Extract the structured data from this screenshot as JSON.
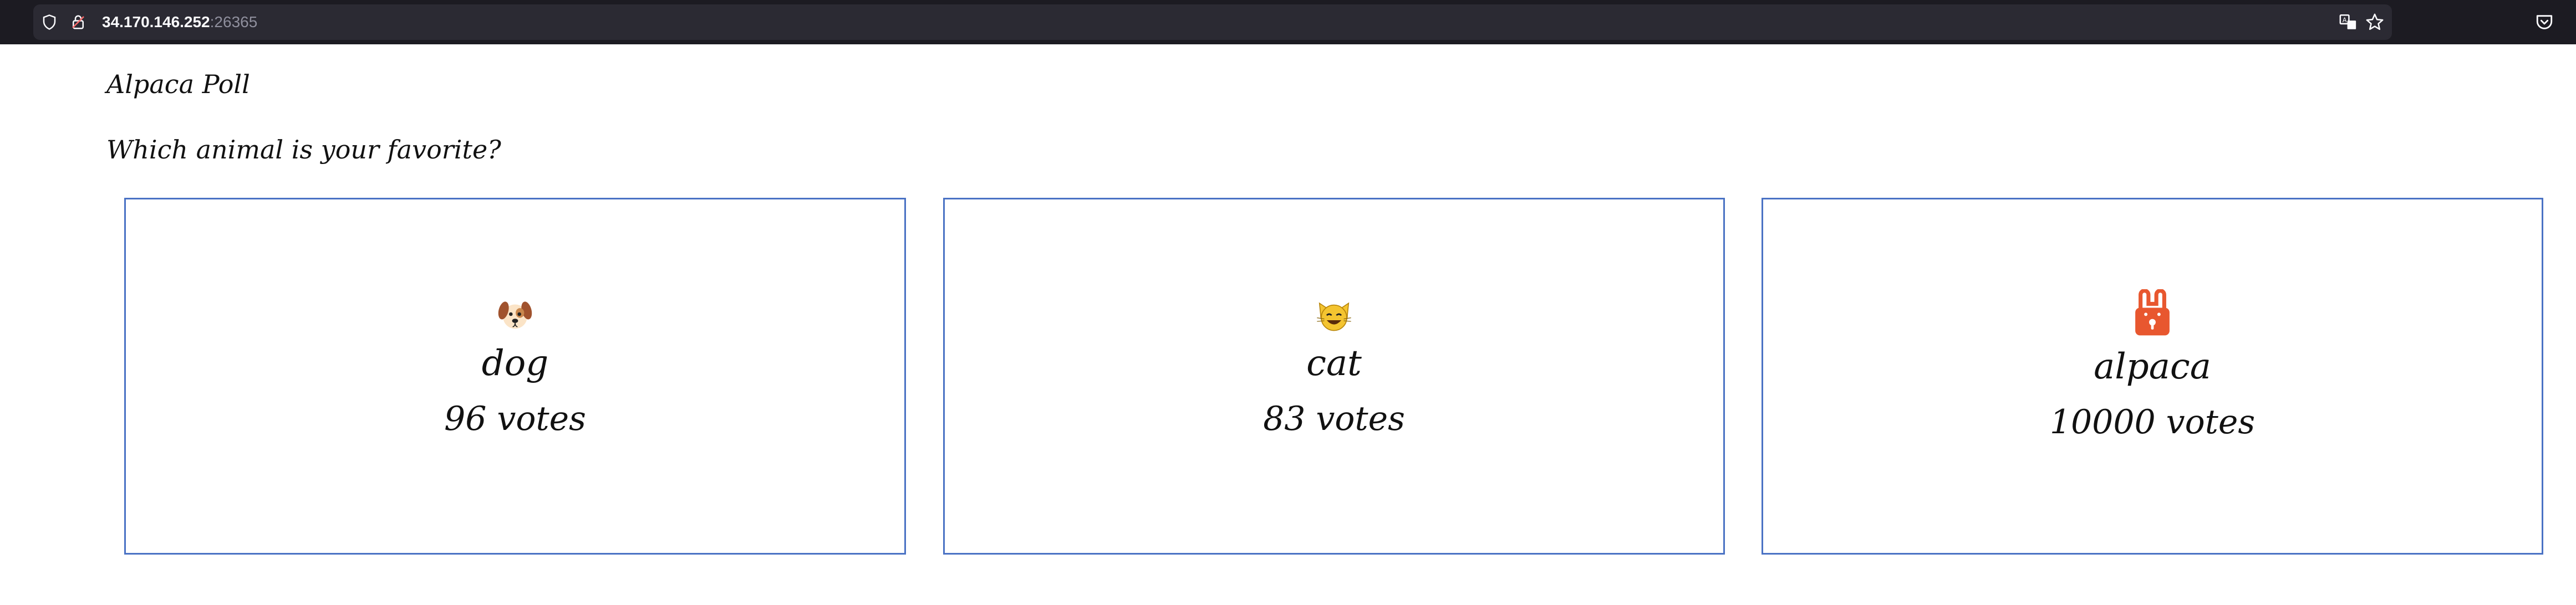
{
  "browser": {
    "url_host": "34.170.146.252",
    "url_port": ":26365",
    "icons": [
      "shield-icon",
      "lock-icon",
      "translate-icon",
      "star-icon",
      "pocket-icon"
    ]
  },
  "page": {
    "title": "Alpaca Poll",
    "question": "Which animal is your favorite?"
  },
  "options": [
    {
      "icon": "dog-face-icon",
      "name": "dog",
      "votes": "96 votes"
    },
    {
      "icon": "cat-face-icon",
      "name": "cat",
      "votes": "83 votes"
    },
    {
      "icon": "alpaca-lock-icon",
      "name": "alpaca",
      "votes": "10000 votes"
    }
  ],
  "colors": {
    "browser_bar": "#1c1b22",
    "url_field": "#2b2a33",
    "card_border": "#4a72c4",
    "alpaca_icon": "#e8572f"
  }
}
